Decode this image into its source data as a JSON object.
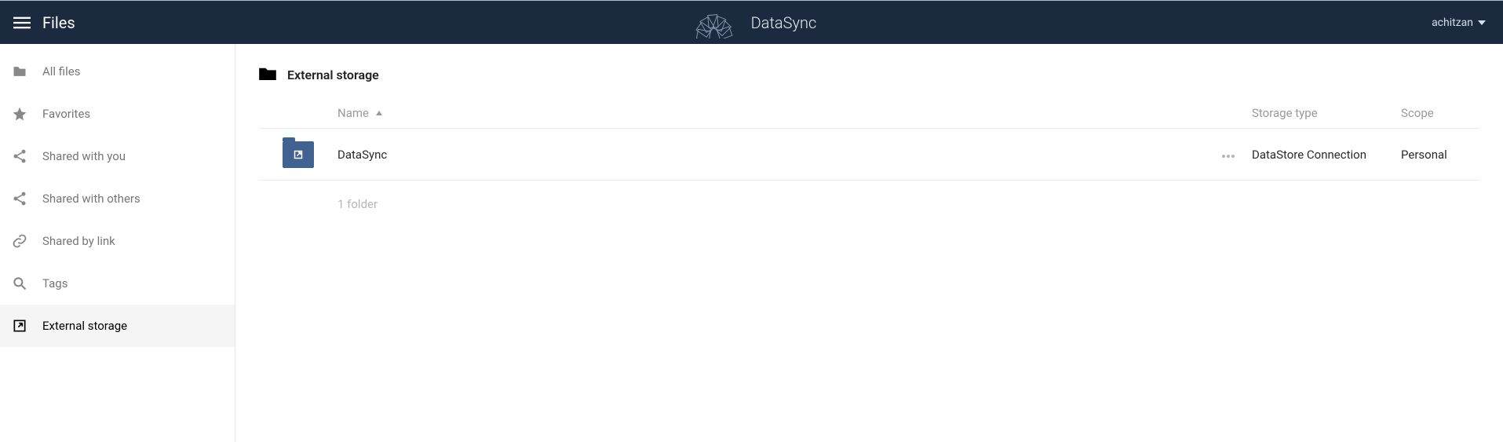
{
  "header": {
    "app_title": "Files",
    "brand_name": "DataSync",
    "username": "achitzan"
  },
  "sidebar": {
    "items": [
      {
        "icon": "folder-icon",
        "label": "All files",
        "active": false
      },
      {
        "icon": "star-icon",
        "label": "Favorites",
        "active": false
      },
      {
        "icon": "share-in-icon",
        "label": "Shared with you",
        "active": false
      },
      {
        "icon": "share-out-icon",
        "label": "Shared with others",
        "active": false
      },
      {
        "icon": "link-icon",
        "label": "Shared by link",
        "active": false
      },
      {
        "icon": "tag-icon",
        "label": "Tags",
        "active": false
      },
      {
        "icon": "external-icon",
        "label": "External storage",
        "active": true
      }
    ]
  },
  "main": {
    "breadcrumb": "External storage",
    "columns": {
      "name": "Name",
      "storage_type": "Storage type",
      "scope": "Scope"
    },
    "rows": [
      {
        "name": "DataSync",
        "storage_type": "DataStore Connection",
        "scope": "Personal"
      }
    ],
    "summary": "1 folder"
  }
}
